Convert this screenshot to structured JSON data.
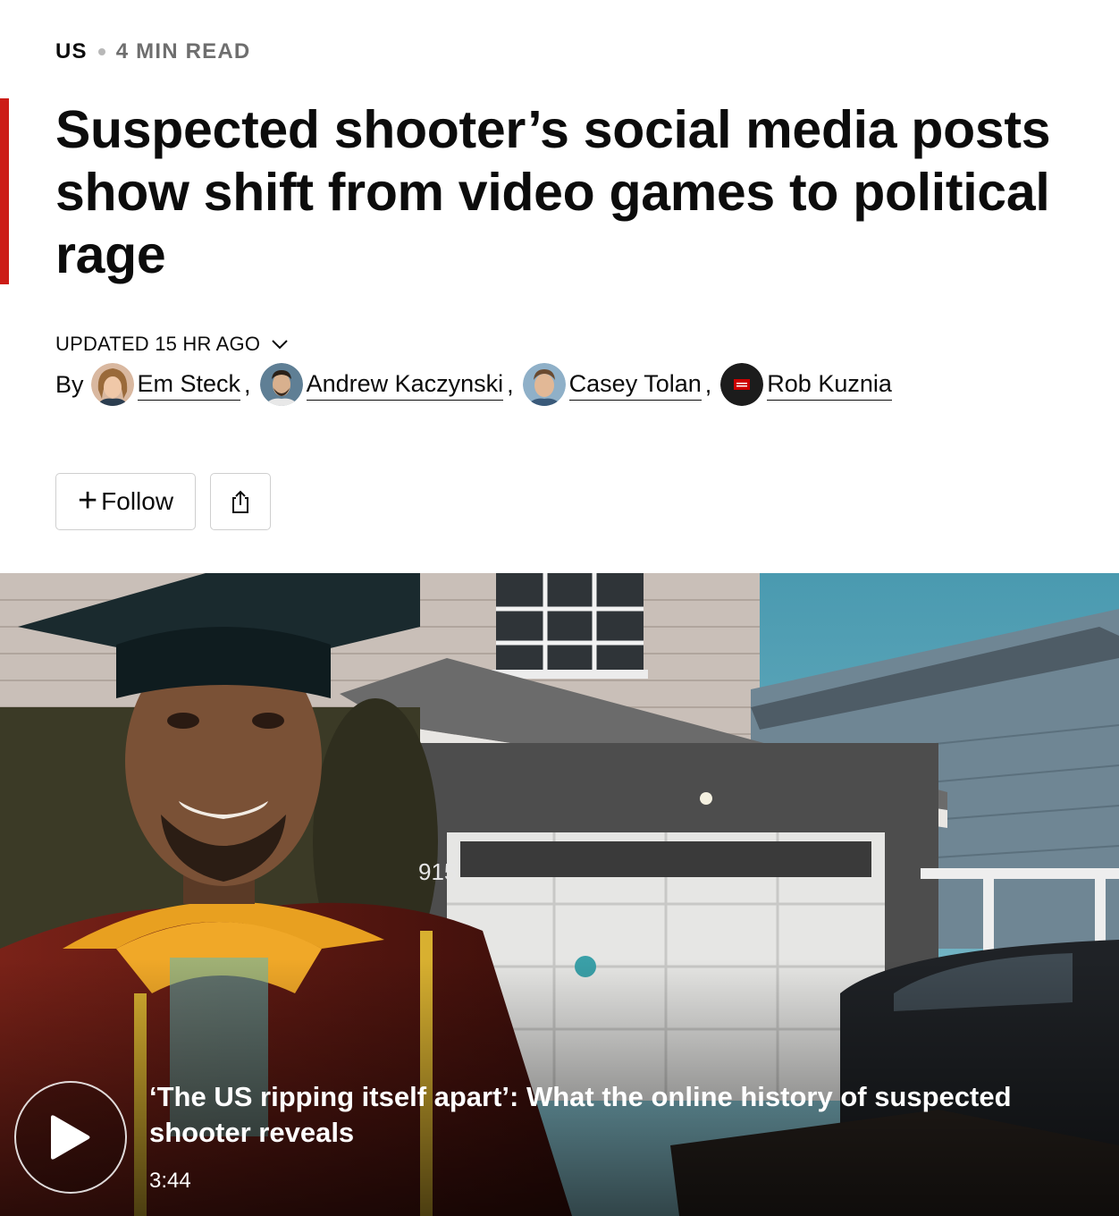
{
  "kicker": {
    "section": "US",
    "read_time": "4 MIN READ"
  },
  "headline": "Suspected shooter’s social media posts show shift from video games to political rage",
  "updated": {
    "label": "UPDATED 15 HR AGO",
    "icon": "chevron-down-icon"
  },
  "byline": {
    "prefix": "By",
    "authors": [
      {
        "name": "Em Steck"
      },
      {
        "name": "Andrew Kaczynski"
      },
      {
        "name": "Casey Tolan"
      },
      {
        "name": "Rob Kuznia"
      }
    ],
    "separator": ","
  },
  "actions": {
    "follow_label": "Follow",
    "follow_icon": "plus-icon",
    "share_icon": "share-icon"
  },
  "video": {
    "title": "‘The US ripping itself apart’: What the online history of suspected shooter reveals",
    "duration": "3:44",
    "play_icon": "play-icon",
    "house_number": "915"
  },
  "colors": {
    "accent": "#cc1c17",
    "text": "#0c0c0c",
    "muted": "#6e6e6e"
  }
}
